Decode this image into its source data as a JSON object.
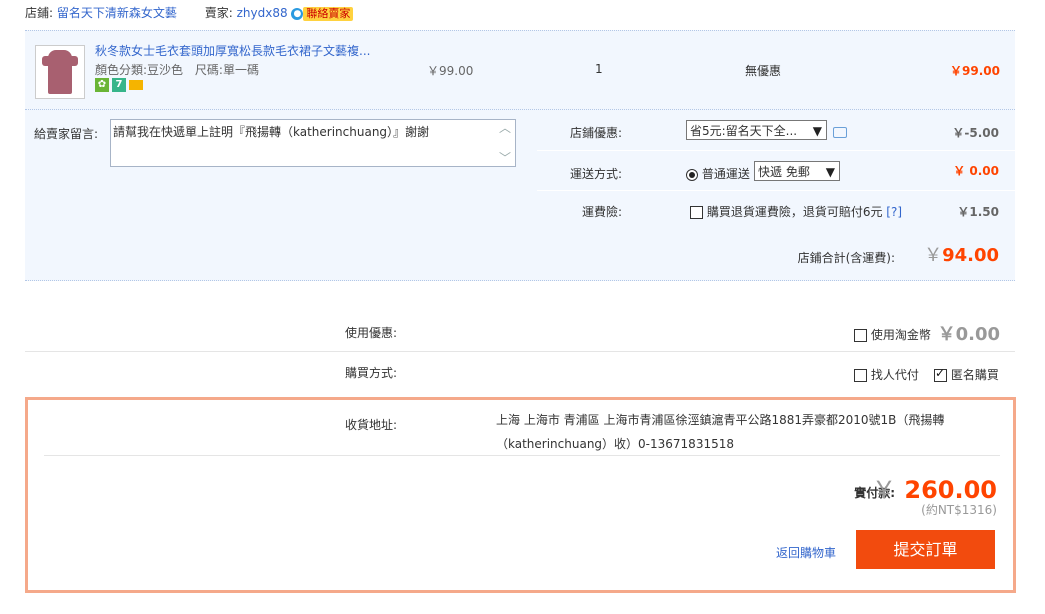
{
  "store": {
    "label": "店鋪:",
    "name": "留名天下清新森女文藝",
    "seller_label": "賣家:",
    "seller_name": "zhydx88",
    "seller_badge": "聯絡賣家"
  },
  "item": {
    "title": "秋冬款女士毛衣套頭加厚寬松長款毛衣裙子文藝複...",
    "color_label": "顏色分類:",
    "color_value": "豆沙色",
    "size_label": "尺碼:",
    "size_value": "單一碼",
    "unit_price": "￥99.00",
    "quantity": "1",
    "promotion": "無優惠",
    "subtotal": "￥99.00",
    "icons": [
      "guarantee-icon",
      "seven-day-return-icon",
      "card-icon"
    ]
  },
  "message": {
    "label": "給賣家留言:",
    "value": "請幫我在快遞單上註明『飛揚轉（katherinchuang）』謝謝"
  },
  "store_discount": {
    "label": "店鋪優惠:",
    "selected": "省5元:留名天下全...",
    "value": "￥-5.00"
  },
  "shipping": {
    "label": "運送方式:",
    "option": "普通運送",
    "selected": "快遞 免郵",
    "value": "￥ 0.00"
  },
  "insurance": {
    "label": "運費險:",
    "checkbox_label": "購買退貨運費險，退貨可賠付6元",
    "help": "[?]",
    "value": "￥1.50"
  },
  "store_total": {
    "label": "店鋪合計(含運費):",
    "currency": "￥",
    "value": "94.00"
  },
  "coupon": {
    "label": "使用優惠:",
    "checkbox_label": "使用淘金幣",
    "value": "￥0.00"
  },
  "purchase": {
    "label": "購買方式:",
    "option1": "找人代付",
    "option2": "匿名購買"
  },
  "address": {
    "label": "收貨地址:",
    "line1": "上海 上海市 青浦區 上海市青浦區徐涇鎮滬青平公路1881弄豪都2010號1B（飛揚轉",
    "line2": "（katherinchuang）收）0-13671831518"
  },
  "payment": {
    "label": "實付款:",
    "currency": "￥",
    "value": "260.00",
    "approx": "(約NT$1316)"
  },
  "actions": {
    "back": "返回購物車",
    "submit": "提交訂單"
  }
}
